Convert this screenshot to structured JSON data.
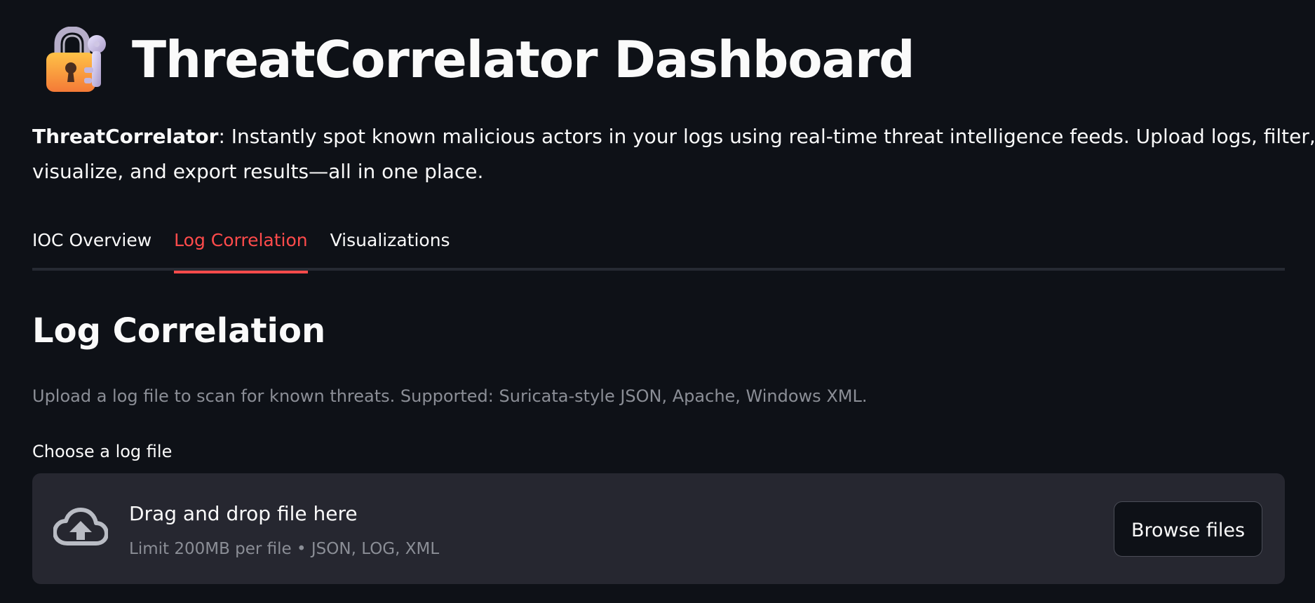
{
  "header": {
    "icon": "locked-with-key-icon",
    "title": "ThreatCorrelator Dashboard"
  },
  "intro": {
    "brand": "ThreatCorrelator",
    "text": ": Instantly spot known malicious actors in your logs using real-time threat intelligence feeds. Upload logs, filter,",
    "continuation": "visualize, and export results—all in one place."
  },
  "tabs": [
    {
      "label": "IOC Overview",
      "active": false
    },
    {
      "label": "Log Correlation",
      "active": true
    },
    {
      "label": "Visualizations",
      "active": false
    }
  ],
  "main": {
    "title": "Log Correlation",
    "caption": "Upload a log file to scan for known threats. Supported: Suricata-style JSON, Apache, Windows XML.",
    "uploader": {
      "label": "Choose a log file",
      "icon": "cloud-upload-icon",
      "title": "Drag and drop file here",
      "limit": "Limit 200MB per file • JSON, LOG, XML",
      "button": "Browse files"
    }
  },
  "colors": {
    "background": "#0e1117",
    "text": "#fafafa",
    "accent": "#ff4b4b",
    "muted": "#8b8e96",
    "dropzone": "#262730"
  }
}
